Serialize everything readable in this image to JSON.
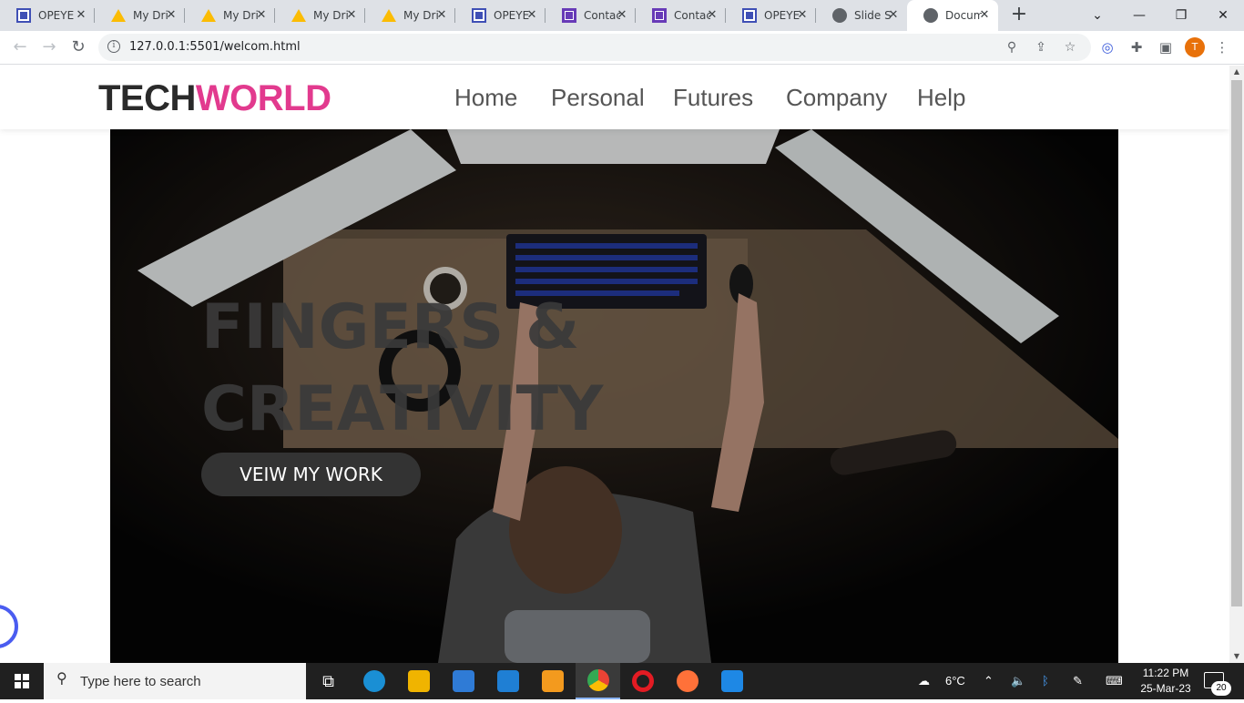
{
  "browser": {
    "tabs": [
      {
        "title": "OPEYE",
        "icon": "forms-icon"
      },
      {
        "title": "My Dri",
        "icon": "google-drive-icon"
      },
      {
        "title": "My Dri",
        "icon": "google-drive-icon"
      },
      {
        "title": "My Dri",
        "icon": "google-drive-icon"
      },
      {
        "title": "My Dri",
        "icon": "google-drive-icon"
      },
      {
        "title": "OPEYE",
        "icon": "forms-icon"
      },
      {
        "title": "Contac",
        "icon": "google-forms-icon"
      },
      {
        "title": "Contac",
        "icon": "google-forms-icon"
      },
      {
        "title": "OPEYE",
        "icon": "forms-icon"
      },
      {
        "title": "Slide S",
        "icon": "globe-icon"
      },
      {
        "title": "Docum",
        "icon": "globe-icon",
        "active": true
      }
    ],
    "new_tab": "+",
    "url": "127.0.0.1:5501/welcom.html",
    "profile_initial": "T"
  },
  "site": {
    "logo_part1": "TECH",
    "logo_part2": "WORLD",
    "logo_colors": {
      "part1": "#2a2a2a",
      "part2": "#e23a8e"
    },
    "nav": [
      "Home",
      "Personal",
      "Futures",
      "Company",
      "Help"
    ],
    "hero": {
      "title_line1": "FINGERS &",
      "title_line2": "CREATIVITY",
      "button": "VEIW MY WORK"
    }
  },
  "taskbar": {
    "search_placeholder": "Type here to search",
    "apps": [
      "task-view-icon",
      "edge-icon",
      "file-explorer-icon",
      "store-icon",
      "mail-icon",
      "uc-browser-icon",
      "chrome-icon",
      "opera-icon",
      "firefox-icon",
      "vscode-icon"
    ],
    "weather": "6°C",
    "time": "11:22 PM",
    "date": "25-Mar-23",
    "notifications": "20"
  }
}
